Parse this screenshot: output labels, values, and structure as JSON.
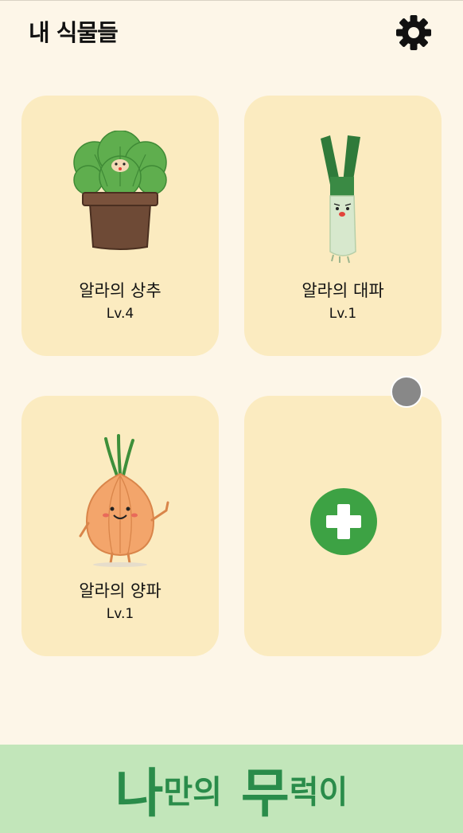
{
  "header": {
    "title": "내 식물들",
    "settings_icon": "gear-icon"
  },
  "plants": [
    {
      "name": "알라의 상추",
      "level": "Lv.4",
      "icon": "lettuce-illustration"
    },
    {
      "name": "알라의 대파",
      "level": "Lv.1",
      "icon": "green-onion-illustration"
    },
    {
      "name": "알라의 양파",
      "level": "Lv.1",
      "icon": "onion-illustration"
    }
  ],
  "add_card": {
    "icon": "plus-icon"
  },
  "footer": {
    "logo_part1": "나",
    "logo_part2": "만의",
    "logo_part3": "무",
    "logo_part4": "럭이"
  },
  "colors": {
    "background": "#fdf6e8",
    "card": "#fbebc0",
    "accent_green": "#3da244",
    "footer_bg": "#c2e6ba"
  }
}
